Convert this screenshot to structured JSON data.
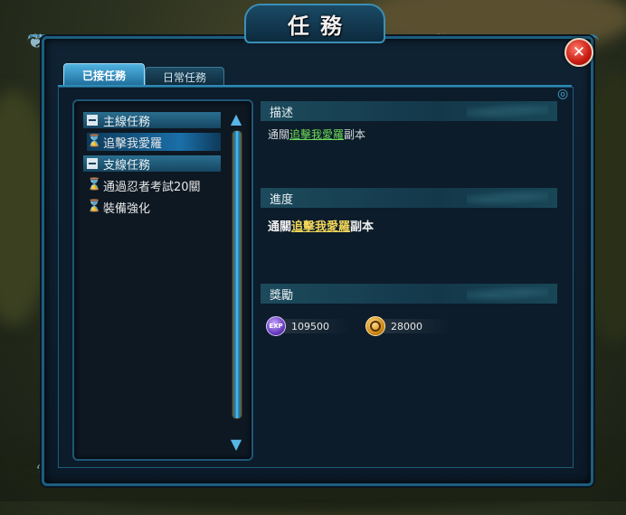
{
  "window": {
    "title": "任務",
    "close_label": "✕"
  },
  "tabs": [
    {
      "label": "已接任務",
      "active": true
    },
    {
      "label": "日常任務",
      "active": false
    }
  ],
  "quest_list": {
    "categories": [
      {
        "label": "主線任務",
        "quests": [
          {
            "label": "追擊我愛羅",
            "selected": true
          }
        ]
      },
      {
        "label": "支線任務",
        "quests": [
          {
            "label": "通過忍者考試20關",
            "selected": false
          },
          {
            "label": "裝備強化",
            "selected": false
          }
        ]
      }
    ]
  },
  "details": {
    "description": {
      "header": "描述",
      "prefix": "通關",
      "link": "追擊我愛羅",
      "suffix": "副本"
    },
    "progress": {
      "header": "進度",
      "prefix": "通關",
      "link": "追擊我愛羅",
      "suffix": "副本"
    },
    "rewards": {
      "header": "獎勵",
      "items": [
        {
          "icon": "exp-icon",
          "icon_text": "EXP",
          "value": "109500"
        },
        {
          "icon": "coin-icon",
          "value": "28000"
        }
      ]
    }
  },
  "colors": {
    "accent": "#2d8ab5",
    "link_green": "#6edc5a",
    "link_yellow": "#f2d65a",
    "close_red": "#c81a10"
  }
}
